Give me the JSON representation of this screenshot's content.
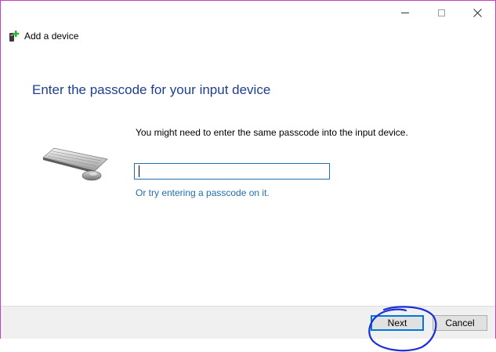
{
  "window": {
    "title": "Add a device",
    "controls": {
      "minimize": "minimize",
      "maximize": "maximize",
      "close": "close"
    }
  },
  "content": {
    "heading": "Enter the passcode for your input device",
    "instruction": "You might need to enter the same passcode into the input device.",
    "passcode": {
      "value": "",
      "placeholder": ""
    },
    "alt_link": "Or try entering a passcode on it."
  },
  "footer": {
    "next_label": "Next",
    "cancel_label": "Cancel"
  },
  "colors": {
    "heading": "#1e3f8f",
    "link": "#1f6fb1",
    "window_border": "#c83ec8",
    "annotation": "#1b2fd6"
  }
}
